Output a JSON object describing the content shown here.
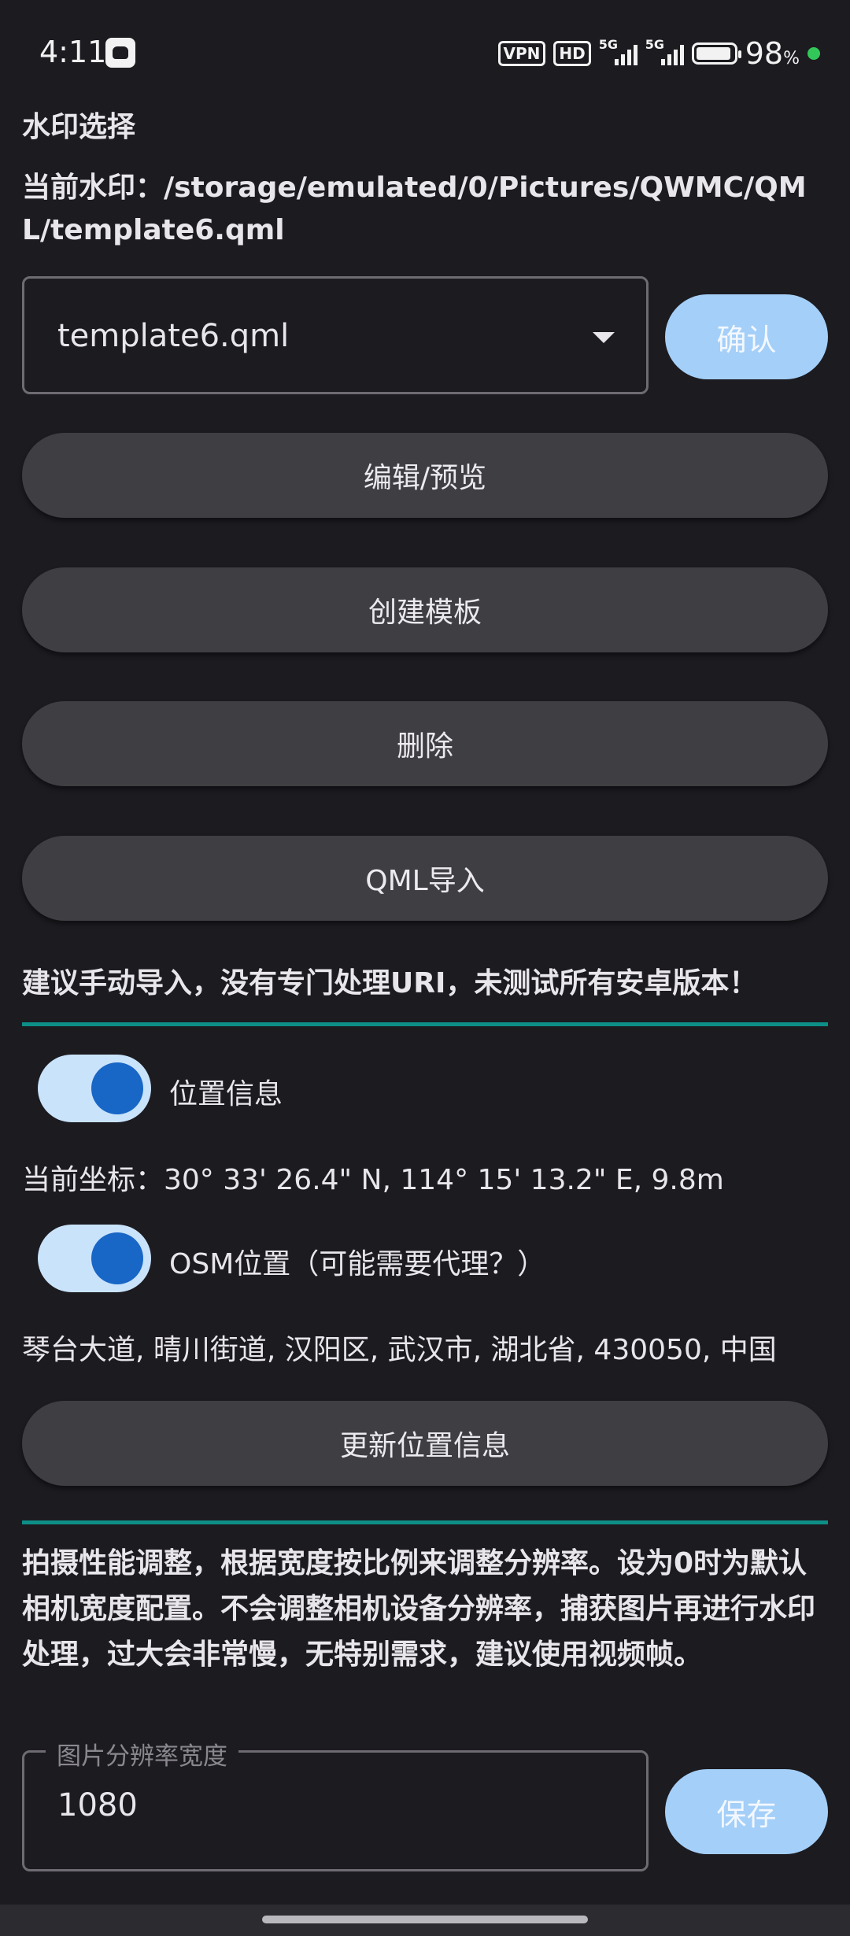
{
  "status_bar": {
    "time": "4:11",
    "vpn": "VPN",
    "hd": "HD",
    "network": "5G",
    "battery": "98",
    "battery_unit": "%",
    "icons": [
      "app-notification-icon",
      "vpn-icon",
      "hd-icon",
      "signal-icon",
      "battery-icon",
      "privacy-dot-icon"
    ]
  },
  "watermark": {
    "title": "水印选择",
    "current": "当前水印：/storage/emulated/0/Pictures/QWMC/QML/template6.qml",
    "selected": "template6.qml",
    "confirm": "确认",
    "edit_preview": "编辑/预览",
    "create_template": "创建模板",
    "delete": "删除",
    "qml_import": "QML导入",
    "warning": "建议手动导入，没有专门处理URI，未测试所有安卓版本！"
  },
  "location": {
    "toggle_label": "位置信息",
    "toggle_on": true,
    "coords": "当前坐标：30° 33' 26.4\" N, 114° 15' 13.2\" E, 9.8m",
    "osm_label": "OSM位置（可能需要代理？）",
    "osm_on": true,
    "address": "琴台大道, 晴川街道, 汉阳区, 武汉市, 湖北省, 430050, 中国",
    "update_button": "更新位置信息"
  },
  "performance": {
    "description": "拍摄性能调整，根据宽度按比例来调整分辨率。设为0时为默认相机宽度配置。不会调整相机设备分辨率，捕获图片再进行水印处理，过大会非常慢，无特别需求，建议使用视频帧。",
    "field_label": "图片分辨率宽度",
    "field_value": "1080",
    "save": "保存"
  },
  "colors": {
    "background": "#1c1b20",
    "accent_button": "#a4cff8",
    "divider": "#0d8f87",
    "toggle_track": "#c9e3fb",
    "toggle_knob": "#1866c6"
  }
}
